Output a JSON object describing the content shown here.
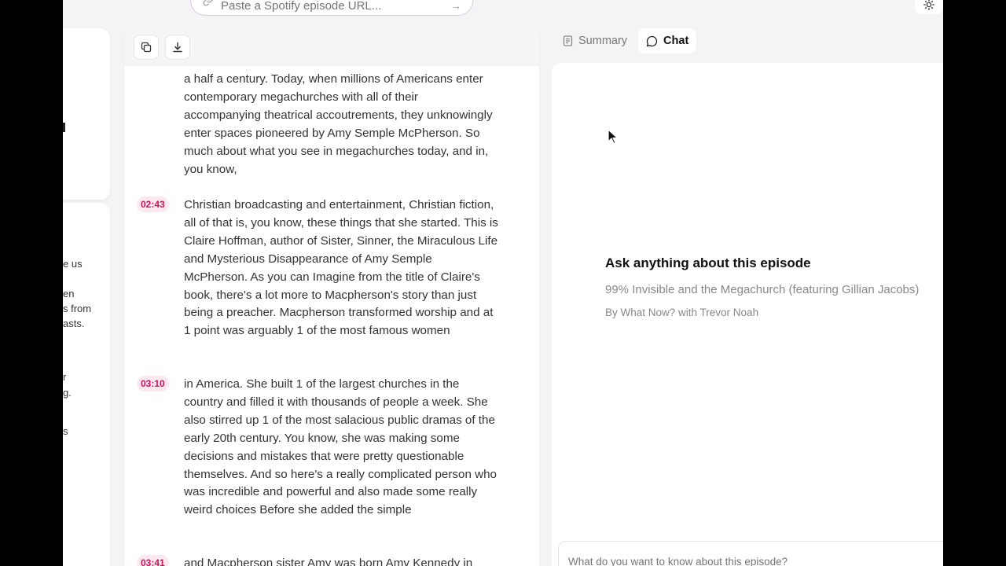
{
  "url_bar": {
    "placeholder": "Paste a Spotify episode URL..."
  },
  "sidebar_fragments": [
    "e us",
    "en",
    "s from",
    "asts.",
    "r",
    "g.",
    "s"
  ],
  "transcript": {
    "segments": [
      {
        "timestamp": "",
        "text": "a half a century. Today, when millions of Americans enter contemporary megachurches with all of their accompanying theatrical accoutrements, they unknowingly enter spaces pioneered by Amy Semple McPherson. So much about what you see in megachurches today, and in, you know,"
      },
      {
        "timestamp": "02:43",
        "text": "Christian broadcasting and entertainment, Christian fiction, all of that is, you know, these things that she started. This is Claire Hoffman, author of Sister, Sinner, the Miraculous Life and Mysterious Disappearance of Amy Semple McPherson. As you can Imagine from the title of Claire's book, there's a lot more to Macpherson's story than just being a preacher. Macpherson transformed worship and at 1 point was arguably 1 of the most famous women"
      },
      {
        "timestamp": "03:10",
        "text": "in America. She built 1 of the largest churches in the country and filled it with thousands of people a week. She also stirred up 1 of the most salacious public dramas of the early 20th century. You know, she was making some decisions and mistakes that were pretty questionable themselves. And so here's a really complicated person who was incredible and powerful and also made some really weird choices Before she added the simple"
      },
      {
        "timestamp": "03:41",
        "text": "and Macpherson sister Amy was born Amy Kennedy in"
      }
    ]
  },
  "tabs": [
    {
      "label": "Summary",
      "active": false
    },
    {
      "label": "Chat",
      "active": true
    }
  ],
  "chat": {
    "title": "Ask anything about this episode",
    "episode": "99% Invisible and the Megachurch (featuring Gillian Jacobs)",
    "author": "By What Now? with Trevor Noah",
    "input_placeholder": "What do you want to know about this episode?"
  }
}
